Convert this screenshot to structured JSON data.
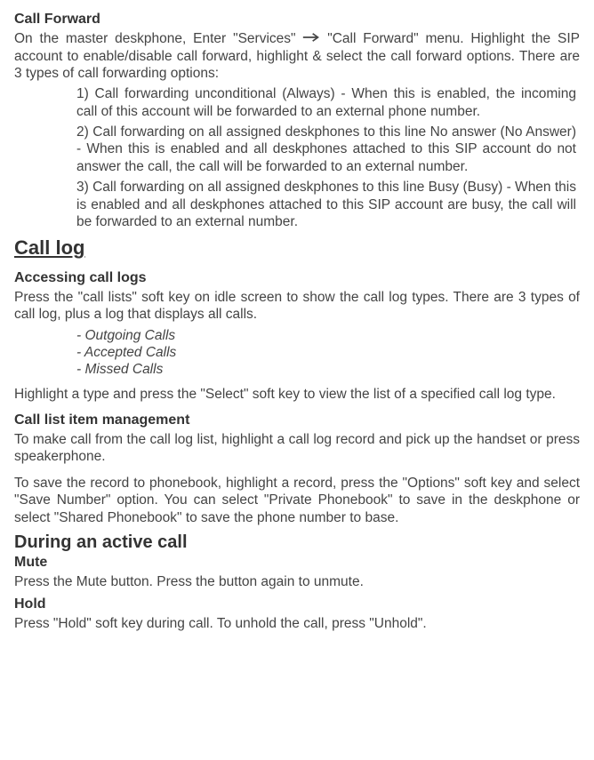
{
  "call_forward": {
    "title": "Call Forward",
    "intro1": "On the master deskphone, Enter \"Services\" ",
    "intro2": " \"Call Forward\" menu. Highlight the SIP account to enable/disable call forward, highlight & select the call forward options. There are 3 types of call forwarding options:",
    "opt1": "1) Call forwarding unconditional (Always) - When this is enabled, the incoming call of this account will be forwarded to an external phone number.",
    "opt2": "2) Call forwarding on all assigned deskphones to this line No answer (No Answer) - When this is enabled and all deskphones attached to this SIP account do not answer the call, the call will be forwarded to an external number.",
    "opt3": "3) Call forwarding on all assigned deskphones to this line Busy (Busy) - When this is enabled and all deskphones attached to this SIP account are busy, the call will be forwarded to an external number."
  },
  "call_log": {
    "title": "Call log",
    "access_title": "Accessing call logs",
    "access_text": "Press the \"call lists\" soft key on idle screen to show the call log types. There are 3 types of call log, plus a log that displays all calls.",
    "types": {
      "t1": "- Outgoing Calls",
      "t2": "- Accepted Calls",
      "t3": "- Missed Calls"
    },
    "highlight_text": "Highlight a type and press the \"Select\" soft key to view the list of a specified call log type.",
    "mgmt_title": "Call list item management",
    "mgmt_text1": "To make call from the call log list, highlight a call log record and pick up the handset or press speakerphone.",
    "mgmt_text2": "To save the record to phonebook, highlight a record, press the \"Options\" soft key and select \"Save Number\" option. You can select \"Private Phonebook\" to save in the deskphone or select \"Shared Phonebook\" to save the phone number to base."
  },
  "active_call": {
    "title": "During an active call",
    "mute_title": "Mute",
    "mute_text": "Press the Mute button. Press the button again to unmute.",
    "hold_title": "Hold",
    "hold_text": "Press \"Hold\" soft key during call.  To unhold the call, press \"Unhold\"."
  }
}
